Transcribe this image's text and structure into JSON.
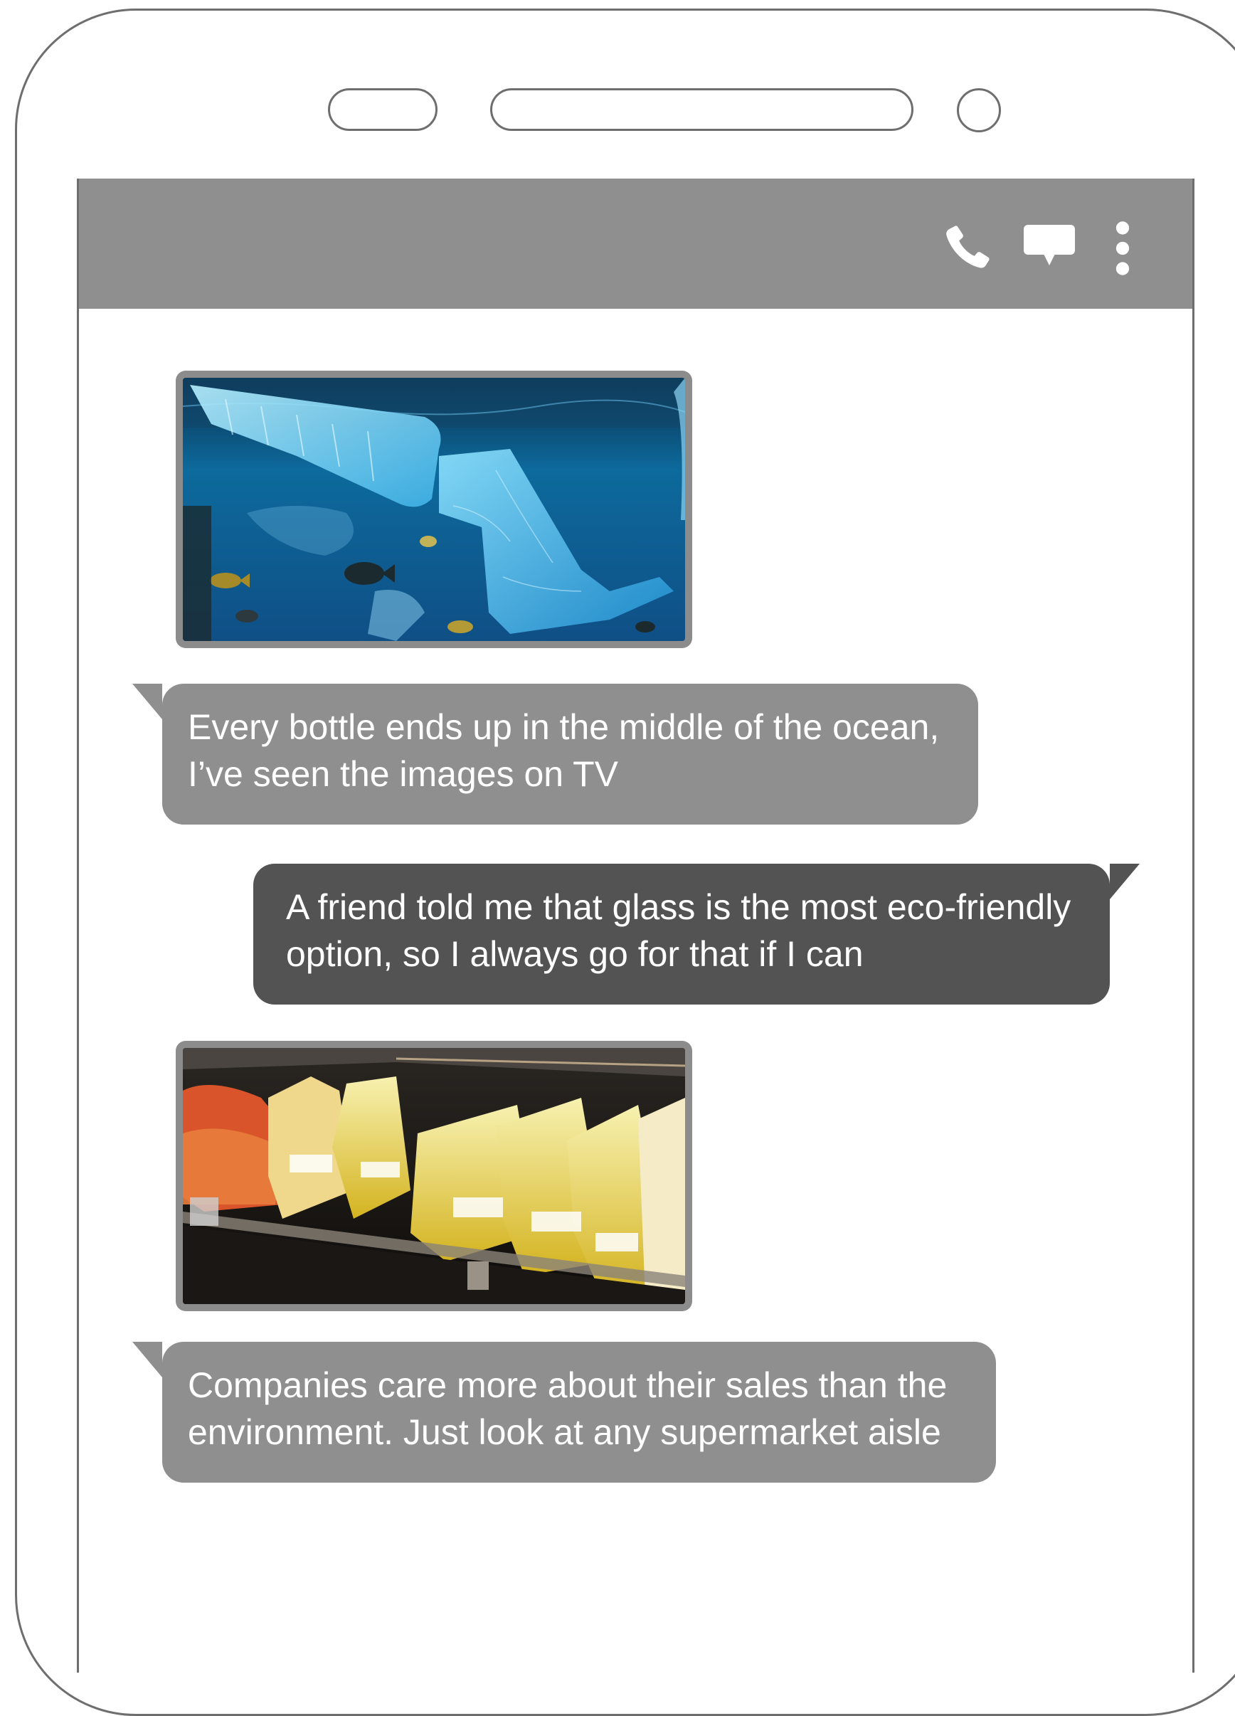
{
  "colors": {
    "outline": "#6e6e6e",
    "toolbar": "#8f8f8f",
    "incoming_bubble": "#8f8f8f",
    "outgoing_bubble": "#535353",
    "bubble_text": "#ffffff"
  },
  "toolbar": {
    "icons": [
      "phone-icon",
      "chat-icon",
      "more-vertical-icon"
    ]
  },
  "messages": [
    {
      "type": "image",
      "direction": "incoming",
      "description_icon": "ocean-plastic-photo"
    },
    {
      "type": "text",
      "direction": "incoming",
      "lines": [
        "Every bottle ends up in the middle of the ocean,",
        "I’ve seen the images on TV"
      ]
    },
    {
      "type": "text",
      "direction": "outgoing",
      "lines": [
        "A friend told me that glass is the most eco-friendly",
        "option, so I  always go for that if I can"
      ]
    },
    {
      "type": "image",
      "direction": "incoming",
      "description_icon": "supermarket-shelf-photo"
    },
    {
      "type": "text",
      "direction": "incoming",
      "lines": [
        "Companies care more about their sales than the",
        "environment. Just look at any supermarket aisle"
      ]
    }
  ]
}
